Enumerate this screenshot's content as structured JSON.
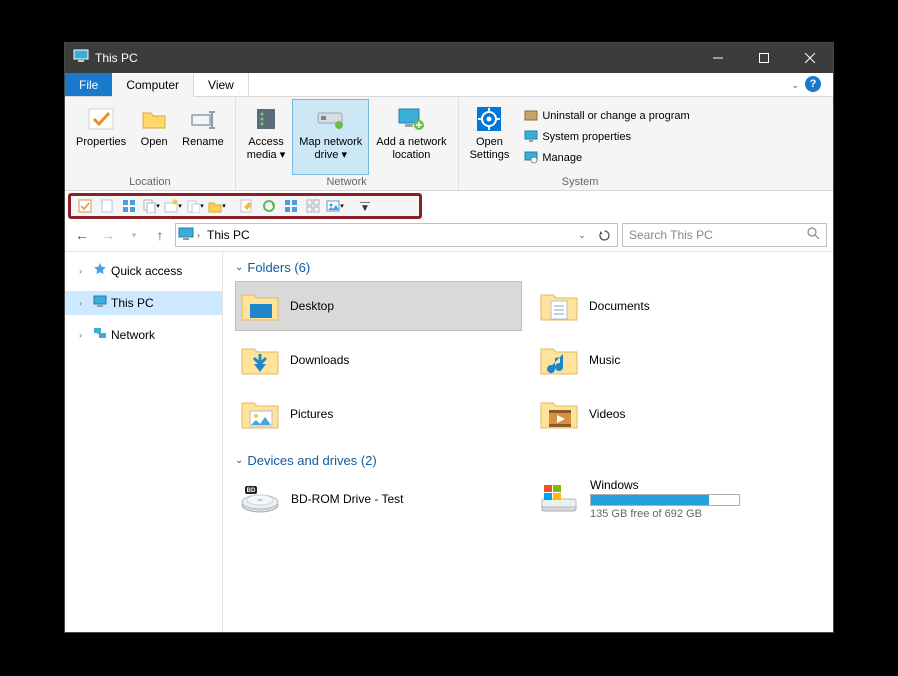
{
  "window": {
    "title": "This PC"
  },
  "tabs": {
    "file": "File",
    "computer": "Computer",
    "view": "View"
  },
  "ribbon": {
    "location": {
      "label": "Location",
      "properties": "Properties",
      "open": "Open",
      "rename": "Rename"
    },
    "network": {
      "label": "Network",
      "access_media": "Access\nmedia ▾",
      "map_drive": "Map network\ndrive ▾",
      "add_location": "Add a network\nlocation"
    },
    "open_settings": "Open\nSettings",
    "system": {
      "label": "System",
      "uninstall": "Uninstall or change a program",
      "properties": "System properties",
      "manage": "Manage"
    }
  },
  "addressbar": {
    "location": "This PC",
    "search_placeholder": "Search This PC"
  },
  "sidebar": {
    "quick_access": "Quick access",
    "this_pc": "This PC",
    "network": "Network"
  },
  "content": {
    "folders_header": "Folders (6)",
    "devices_header": "Devices and drives (2)",
    "folders": [
      {
        "name": "Desktop"
      },
      {
        "name": "Documents"
      },
      {
        "name": "Downloads"
      },
      {
        "name": "Music"
      },
      {
        "name": "Pictures"
      },
      {
        "name": "Videos"
      }
    ],
    "drives": {
      "bd": "BD-ROM Drive - Test",
      "windows": {
        "name": "Windows",
        "free_text": "135 GB free of 692 GB",
        "used_percent": 80
      }
    }
  }
}
